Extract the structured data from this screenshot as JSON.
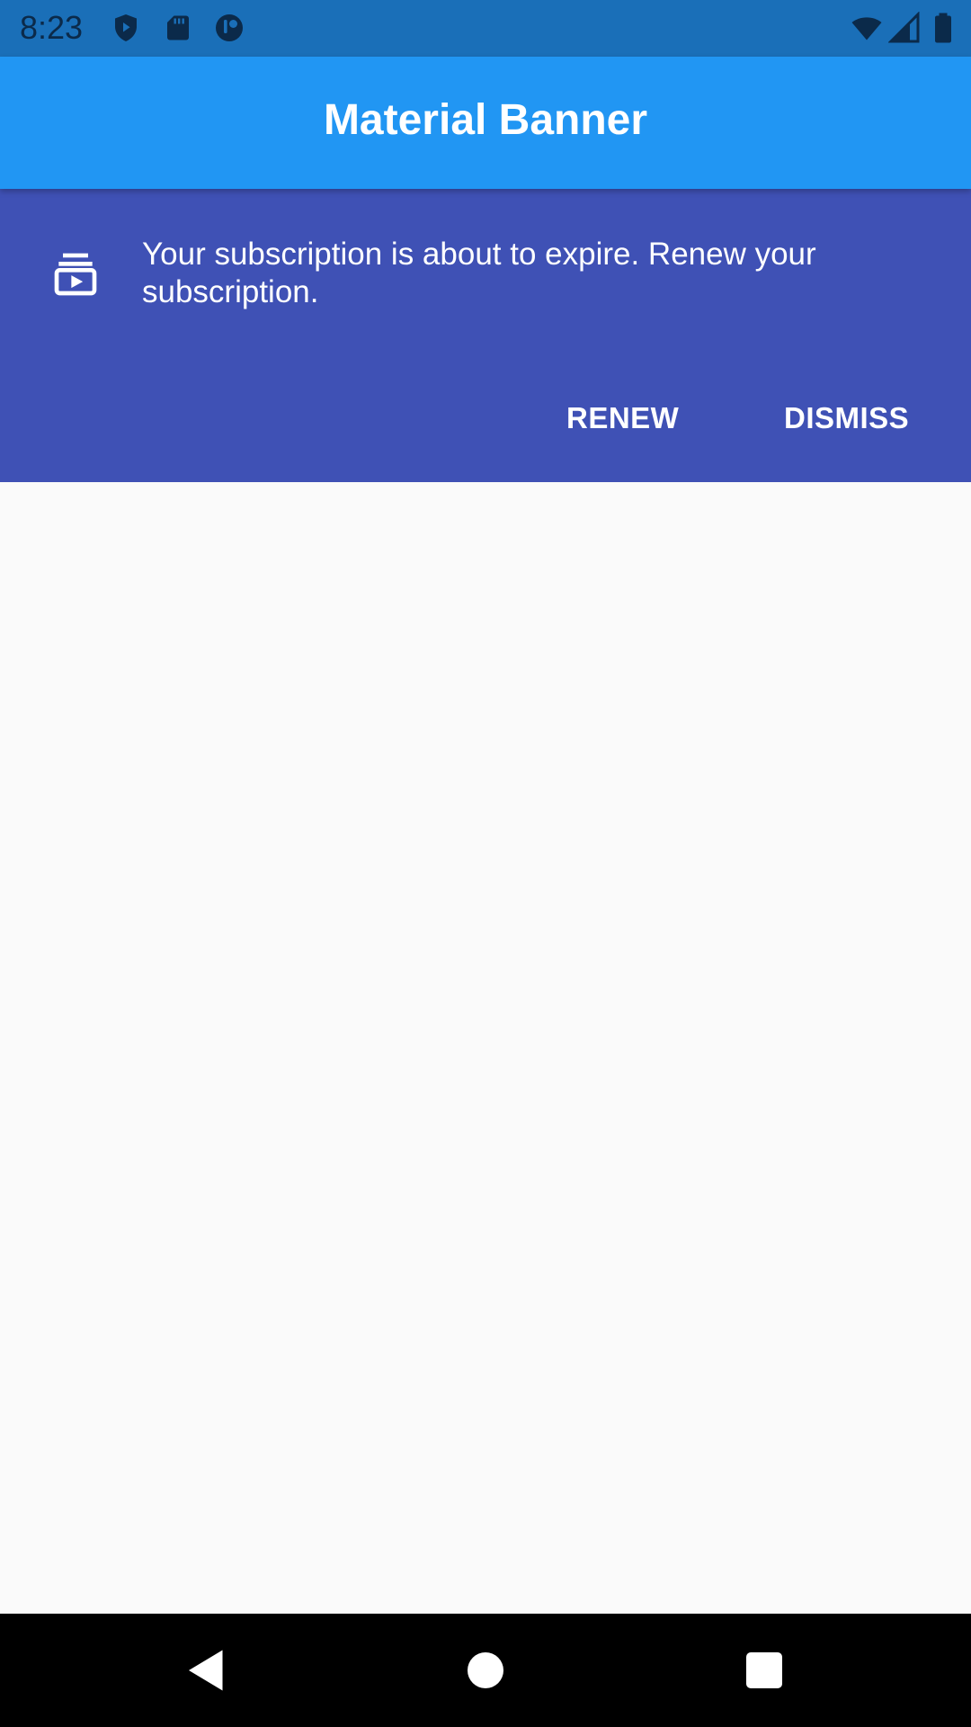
{
  "status_bar": {
    "time": "8:23",
    "icons": [
      "shield-play-icon",
      "sd-card-icon",
      "app-badge-icon",
      "wifi-icon",
      "signal-icon",
      "battery-icon"
    ],
    "background": "#1a6fb8"
  },
  "app_bar": {
    "title": "Material Banner",
    "background": "#2196f3"
  },
  "banner": {
    "icon": "subscriptions-icon",
    "message": "Your subscription is about to expire. Renew your subscription.",
    "actions": {
      "renew_label": "RENEW",
      "dismiss_label": "DISMISS"
    },
    "background": "#3f51b5"
  },
  "nav_bar": {
    "buttons": [
      "back-icon",
      "home-icon",
      "recents-icon"
    ]
  }
}
